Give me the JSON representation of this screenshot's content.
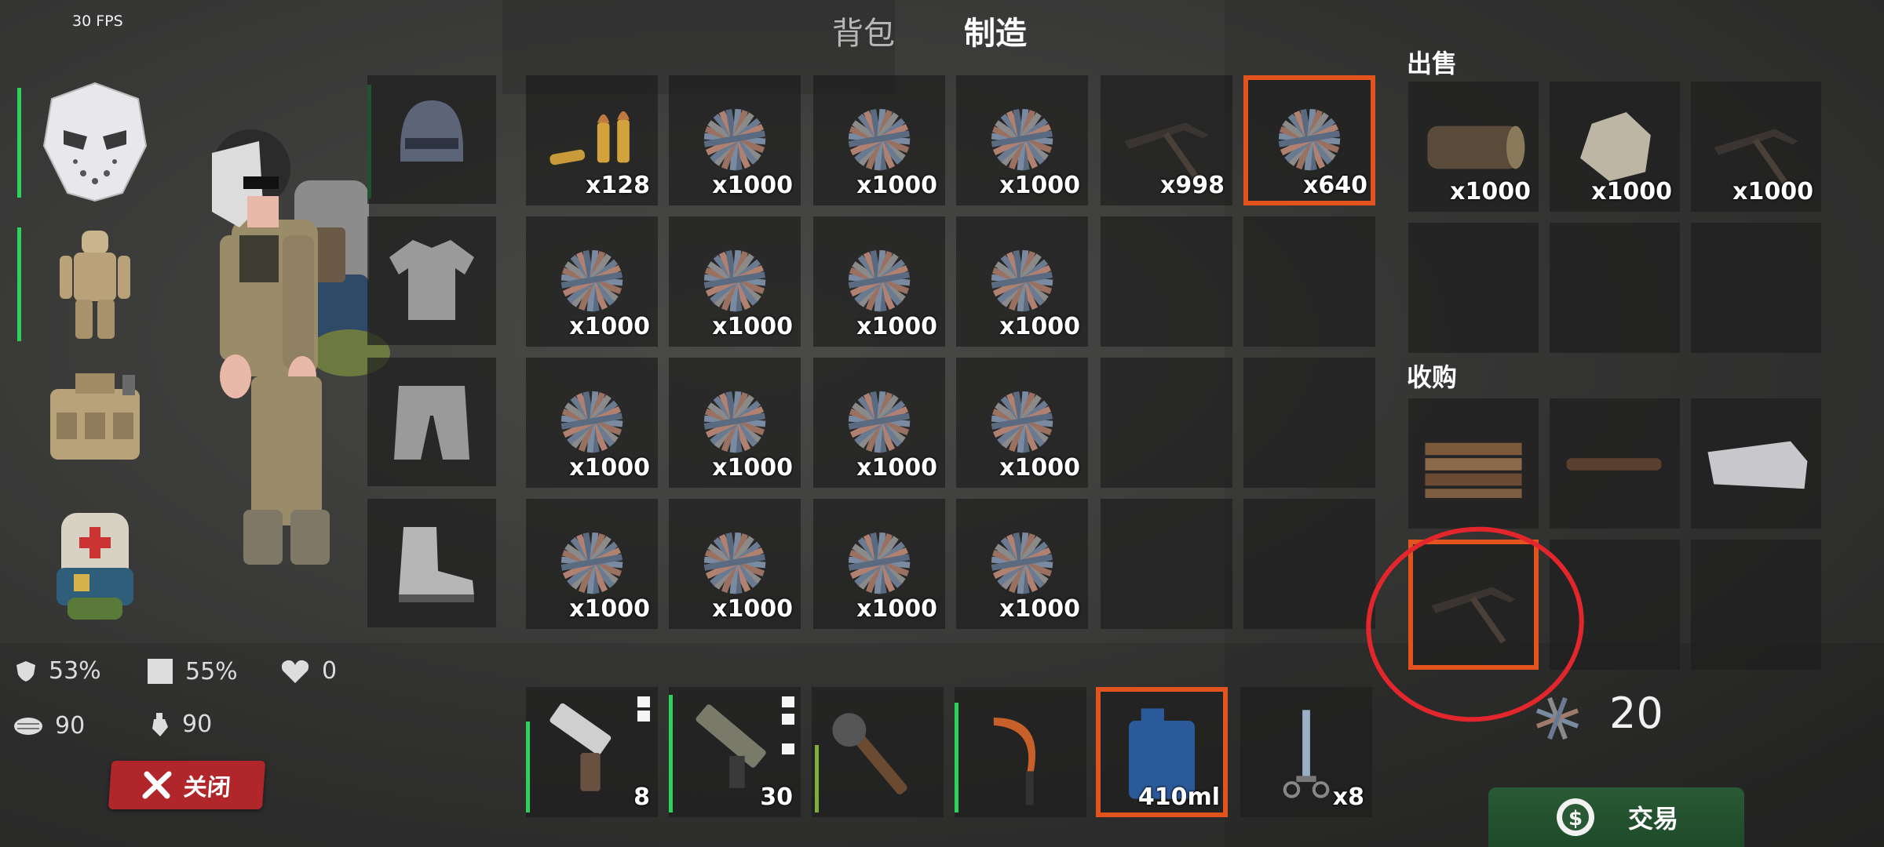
{
  "hud": {
    "fps": "30 FPS"
  },
  "tabs": [
    {
      "label": "背包",
      "active": false
    },
    {
      "label": "制造",
      "active": true
    }
  ],
  "colors": {
    "selected": "#e2531d",
    "health_bar": "#2bd35a",
    "close": "#b1262b",
    "trade": "#1e4a29",
    "annotation": "#e3262c"
  },
  "equipment_left": [
    {
      "icon": "hockey-mask-icon"
    },
    {
      "icon": "tactical-suit-icon"
    },
    {
      "icon": "tactical-vest-icon"
    },
    {
      "icon": "medic-backpack-icon"
    }
  ],
  "clothing_slots": [
    {
      "icon": "helmet-icon"
    },
    {
      "icon": "tshirt-icon"
    },
    {
      "icon": "pants-icon"
    },
    {
      "icon": "boots-icon"
    }
  ],
  "inventory": [
    [
      {
        "icon": "ammo-icon",
        "qty": "x128"
      },
      {
        "icon": "wire-bundle-icon",
        "qty": "x1000"
      },
      {
        "icon": "wire-bundle-icon",
        "qty": "x1000"
      },
      {
        "icon": "wire-bundle-icon",
        "qty": "x1000"
      },
      {
        "icon": "pickaxe-icon",
        "qty": "x998"
      },
      {
        "icon": "wire-bundle-icon",
        "qty": "x640",
        "selected": true
      }
    ],
    [
      {
        "icon": "wire-bundle-icon",
        "qty": "x1000"
      },
      {
        "icon": "wire-bundle-icon",
        "qty": "x1000"
      },
      {
        "icon": "wire-bundle-icon",
        "qty": "x1000"
      },
      {
        "icon": "wire-bundle-icon",
        "qty": "x1000"
      },
      {},
      {}
    ],
    [
      {
        "icon": "wire-bundle-icon",
        "qty": "x1000"
      },
      {
        "icon": "wire-bundle-icon",
        "qty": "x1000"
      },
      {
        "icon": "wire-bundle-icon",
        "qty": "x1000"
      },
      {
        "icon": "wire-bundle-icon",
        "qty": "x1000"
      },
      {},
      {}
    ],
    [
      {
        "icon": "wire-bundle-icon",
        "qty": "x1000"
      },
      {
        "icon": "wire-bundle-icon",
        "qty": "x1000"
      },
      {
        "icon": "wire-bundle-icon",
        "qty": "x1000"
      },
      {
        "icon": "wire-bundle-icon",
        "qty": "x1000"
      },
      {},
      {}
    ]
  ],
  "stats": {
    "armor": "53%",
    "coverage": "55%",
    "health": "0",
    "food": "90",
    "water": "90"
  },
  "close_label": "关闭",
  "hotbar": [
    {
      "icon": "pistol-icon",
      "qty": "8"
    },
    {
      "icon": "smg-icon",
      "qty": "30"
    },
    {
      "icon": "spiked-club-icon",
      "qty": ""
    },
    {
      "icon": "sickle-icon",
      "qty": ""
    },
    {
      "icon": "jerrycan-icon",
      "qty": "410ml",
      "selected": true
    },
    {
      "icon": "syringe-icon",
      "qty": "x8"
    }
  ],
  "sell": {
    "title": "出售",
    "items": [
      {
        "icon": "log-icon",
        "qty": "x1000"
      },
      {
        "icon": "stone-icon",
        "qty": "x1000"
      },
      {
        "icon": "pickaxe-icon",
        "qty": "x1000"
      },
      {},
      {},
      {}
    ]
  },
  "buy": {
    "title": "收购",
    "items": [
      {
        "icon": "planks-icon"
      },
      {
        "icon": "pipe-icon"
      },
      {
        "icon": "cloth-icon"
      },
      {
        "icon": "pickaxe-icon",
        "highlighted": true
      },
      {},
      {}
    ]
  },
  "price": {
    "icon": "wire-bundle-icon",
    "value": "20"
  },
  "trade_label": "交易"
}
